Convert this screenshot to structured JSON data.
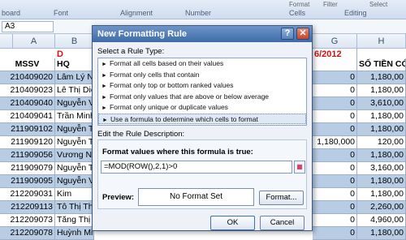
{
  "ribbon": {
    "groups": [
      "board",
      "Font",
      "Alignment",
      "Number",
      "Cells",
      "Editing"
    ],
    "format_label": "Format",
    "sort_label": "Select",
    "filter_label": "Filter"
  },
  "formula_bar": {
    "name_box": "A3"
  },
  "columns": [
    "A",
    "B",
    "G",
    "H"
  ],
  "sheet": {
    "title_fragment_left": "D",
    "title_fragment_right": "6/2012",
    "headers": {
      "a": "MSSV",
      "b": "HQ",
      "h": "SỐ TIỀN CÓ"
    },
    "rows": [
      {
        "mssv": "210409020",
        "name": "Lâm Lý N",
        "g": "0",
        "h": "1,180,00"
      },
      {
        "mssv": "210409023",
        "name": "Lê Thị Diệ",
        "g": "0",
        "h": "1,180,00"
      },
      {
        "mssv": "210409040",
        "name": "Nguyễn V",
        "g": "0",
        "h": "3,610,00"
      },
      {
        "mssv": "210409041",
        "name": "Trần Minh",
        "g": "0",
        "h": "1,180,00"
      },
      {
        "mssv": "211909102",
        "name": "Nguyễn Th",
        "g": "0",
        "h": "1,180,00"
      },
      {
        "mssv": "211909120",
        "name": "Nguyễn Th",
        "g": "1,180,000",
        "h": "120,00"
      },
      {
        "mssv": "211909056",
        "name": "Vương Ng",
        "g": "0",
        "h": "1,180,00"
      },
      {
        "mssv": "211909079",
        "name": "Nguyễn T",
        "g": "0",
        "h": "3,160,00"
      },
      {
        "mssv": "211909095",
        "name": "Nguyễn V",
        "g": "0",
        "h": "1,180,00"
      },
      {
        "mssv": "212209031",
        "name": "Kim",
        "g": "0",
        "h": "1,180,00"
      },
      {
        "mssv": "212209113",
        "name": "Tô Thị Th",
        "g": "0",
        "h": "2,260,00"
      },
      {
        "mssv": "212209073",
        "name": "Tăng Thị",
        "g": "0",
        "h": "4,960,00"
      },
      {
        "mssv": "212209078",
        "name": "Huỳnh Mi",
        "g": "0",
        "h": "1,180,00"
      }
    ]
  },
  "dialog": {
    "title": "New Formatting Rule",
    "help": "?",
    "close": "✕",
    "select_type_label": "Select a Rule Type:",
    "rule_types": [
      "Format all cells based on their values",
      "Format only cells that contain",
      "Format only top or bottom ranked values",
      "Format only values that are above or below average",
      "Format only unique or duplicate values",
      "Use a formula to determine which cells to format"
    ],
    "edit_desc_label": "Edit the Rule Description:",
    "formula_heading": "Format values where this formula is true:",
    "formula": "=MOD(ROW(),2,1)>0",
    "preview_label": "Preview:",
    "preview_text": "No Format Set",
    "format_button": "Format...",
    "ok": "OK",
    "cancel": "Cancel"
  },
  "colors": {
    "row_blue": "#b8cce4",
    "title_red": "#d21010",
    "dialog_title": "#3d6aa8"
  }
}
